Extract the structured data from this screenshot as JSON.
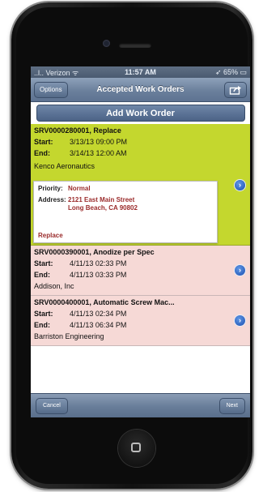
{
  "status_bar": {
    "carrier": "..l.. Verizon ᯤ",
    "time": "11:57 AM",
    "battery": "➶ 65% ▭"
  },
  "nav": {
    "options_label": "Options",
    "title": "Accepted Work Orders",
    "share_icon": "share-icon"
  },
  "add_button_label": "Add Work Order",
  "orders": [
    {
      "title": "SRV0000280001, Replace",
      "start_label": "Start:",
      "start": "3/13/13 09:00 PM",
      "end_label": "End:",
      "end": "3/14/13 12:00 AM",
      "company": "Kenco Aeronautics",
      "color": "#c4d72e",
      "detail": {
        "priority_label": "Priority:",
        "priority": "Normal",
        "address_label": "Address:",
        "address_line1": "2121 East Main Street",
        "address_line2": "Long Beach, CA 90802",
        "note": "Replace"
      }
    },
    {
      "title": "SRV0000390001, Anodize per Spec",
      "start_label": "Start:",
      "start": "4/11/13 02:33 PM",
      "end_label": "End:",
      "end": "4/11/13 03:33 PM",
      "company": "Addison, Inc",
      "color": "#f6d9d6"
    },
    {
      "title": "SRV0000400001, Automatic Screw Mac...",
      "start_label": "Start:",
      "start": "4/11/13 02:34 PM",
      "end_label": "End:",
      "end": "4/11/13 06:34 PM",
      "company": "Barriston Engineering",
      "color": "#f6d9d6"
    }
  ],
  "toolbar": {
    "cancel_label": "Cancel",
    "next_label": "Next"
  }
}
